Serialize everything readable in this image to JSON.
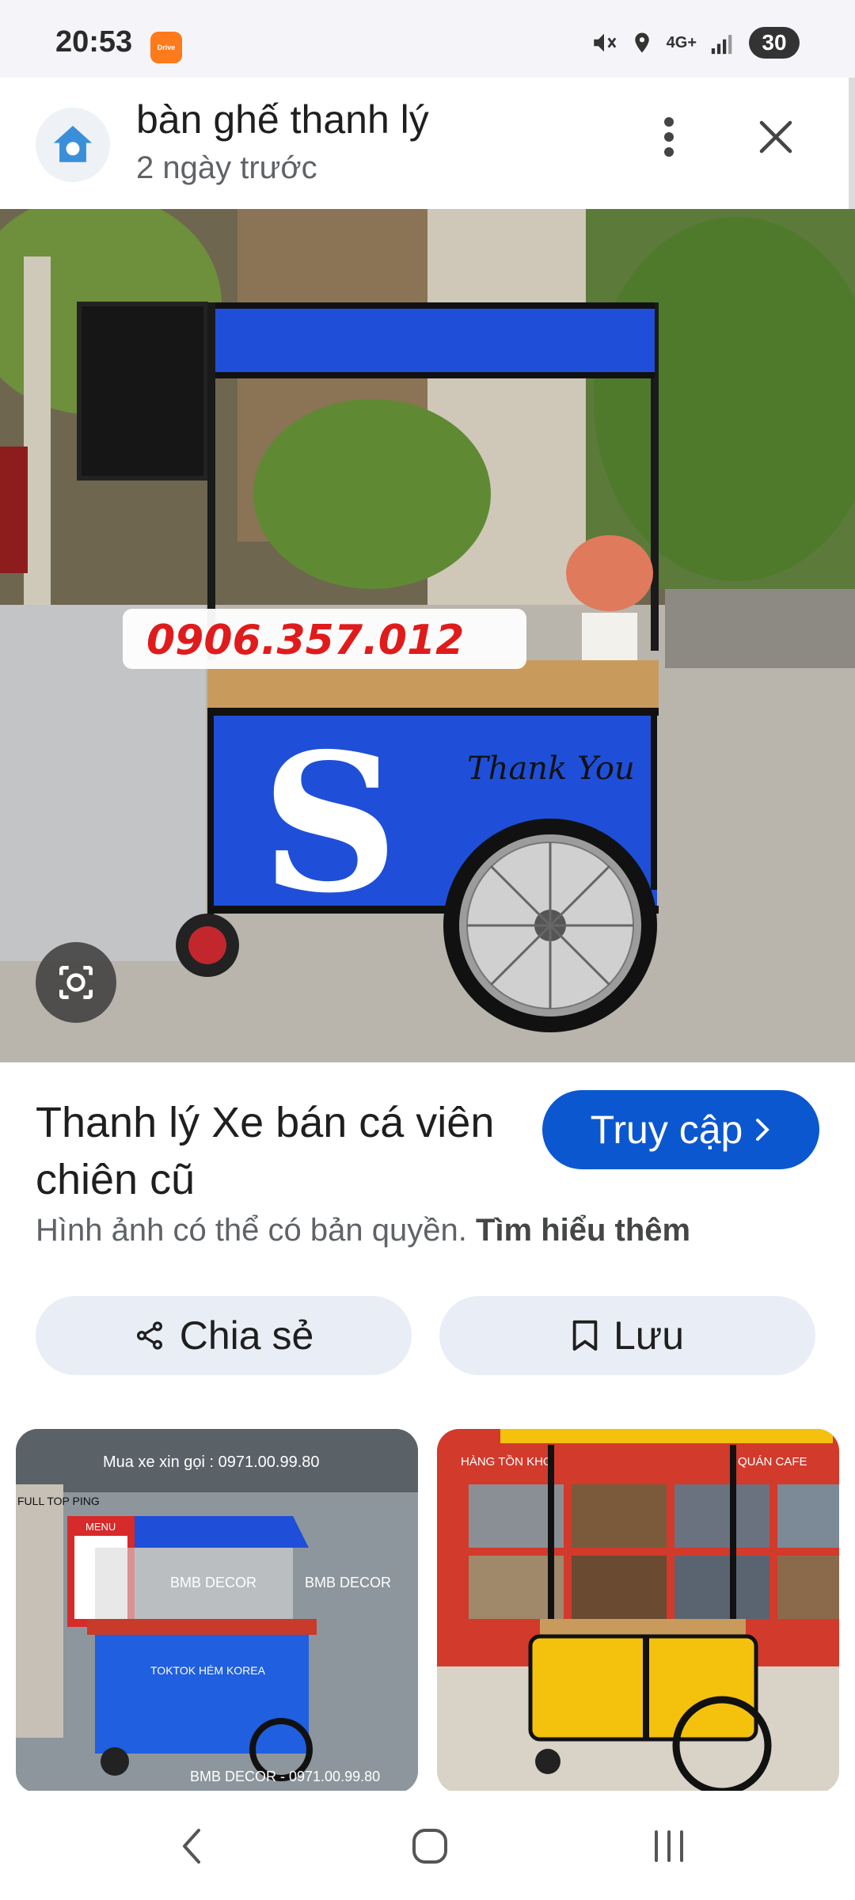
{
  "status_bar": {
    "time": "20:53",
    "app_badge": "Drive",
    "network": "4G+",
    "battery": "30",
    "icons": [
      "mute-icon",
      "location-icon",
      "network-4g-icon",
      "signal-icon",
      "battery-icon"
    ]
  },
  "header": {
    "title": "bàn ghế thanh lý",
    "subtitle": "2 ngày trước"
  },
  "hero": {
    "phone_overlay": "0906.357.012",
    "cart_letter": "S",
    "cart_script": "Thank You"
  },
  "result": {
    "title": "Thanh lý Xe bán cá viên chiên cũ",
    "visit_label": "Truy cập",
    "copyright_text": "Hình ảnh có thể có bản quyền.",
    "learn_more": "Tìm hiểu thêm",
    "share_label": "Chia sẻ",
    "save_label": "Lưu"
  },
  "related": [
    {
      "top_text": "Mua xe xin gọi : 0971.00.99.80",
      "brand_text": "BMB DECOR",
      "brand_text_2": "BMB DECOR",
      "bottom_text": "BMB DECOR - 0971.00.99.80",
      "menu_text": "MENU",
      "cart_text": "TOKTOK HÉM KOREA",
      "sign_text": "FULL TOP PING"
    },
    {
      "banner_text": "HÀNG TỒN KHO",
      "banner_text_2": "QUÁN CAFE"
    }
  ],
  "colors": {
    "accent": "#0b57d0",
    "chip_bg": "#e9eef6",
    "cart_blue": "#1f4fd8",
    "cart_yellow": "#f4c20d"
  }
}
